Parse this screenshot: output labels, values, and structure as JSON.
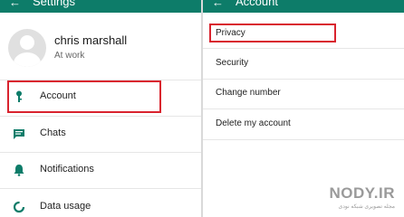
{
  "left": {
    "appbar": {
      "back": "←",
      "title": "Settings"
    },
    "profile": {
      "name": "chris marshall",
      "status": "At work"
    },
    "items": [
      {
        "label": "Account",
        "icon": "key-icon"
      },
      {
        "label": "Chats",
        "icon": "chat-icon"
      },
      {
        "label": "Notifications",
        "icon": "bell-icon"
      },
      {
        "label": "Data usage",
        "icon": "data-usage-icon"
      }
    ]
  },
  "right": {
    "appbar": {
      "back": "←",
      "title": "Account"
    },
    "items": [
      {
        "label": "Privacy"
      },
      {
        "label": "Security"
      },
      {
        "label": "Change number"
      },
      {
        "label": "Delete my account"
      }
    ]
  },
  "watermark": {
    "text": "NODY.IR",
    "subtext": "مجله تصویری شبکه نودی"
  },
  "colors": {
    "appbar": "#0d7c69",
    "icon": "#0d7c69",
    "highlight": "#d9232e"
  }
}
